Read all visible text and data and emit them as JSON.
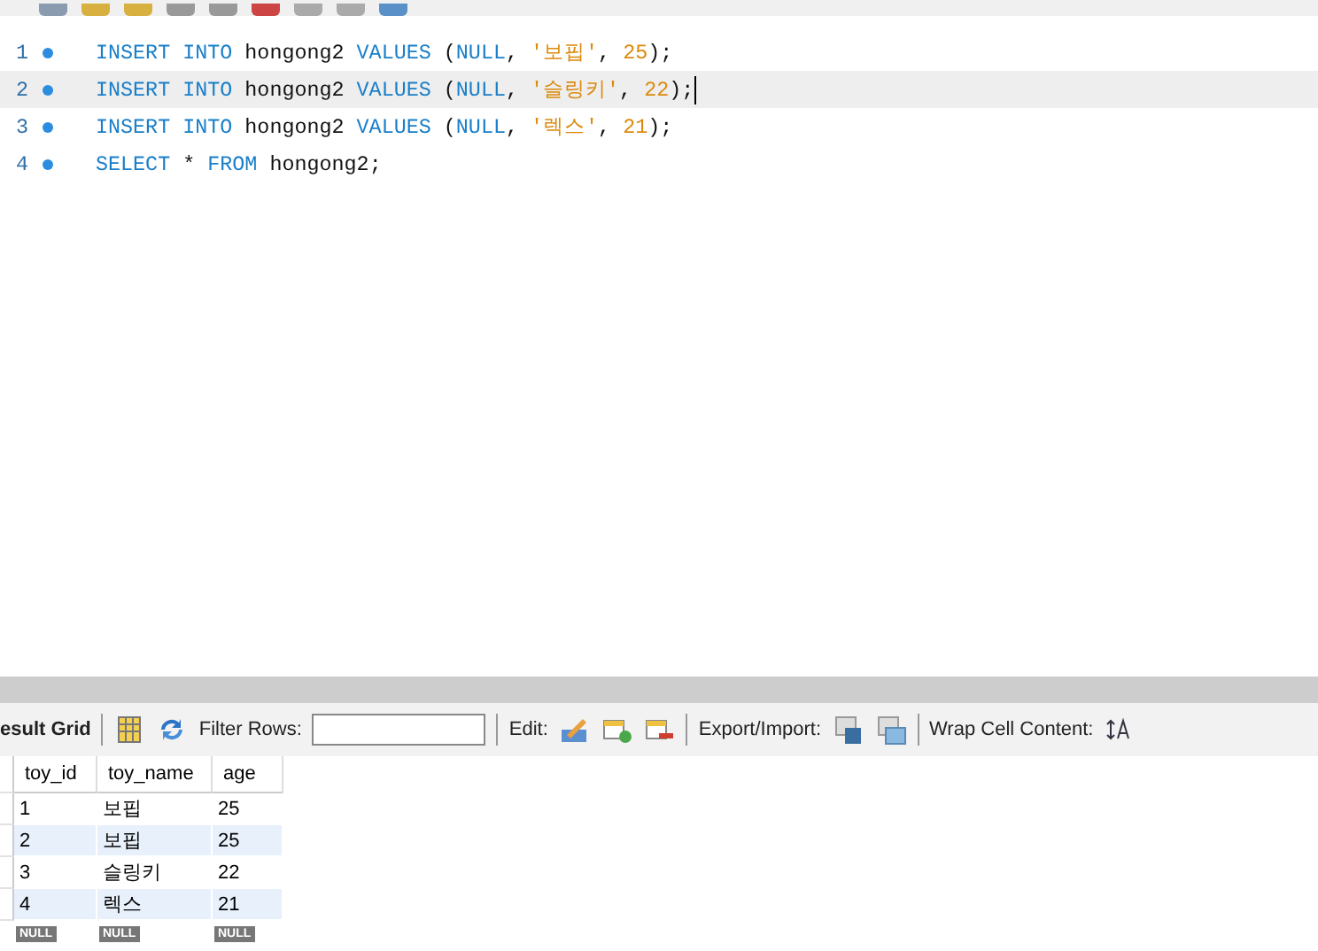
{
  "editor": {
    "lines": [
      {
        "number": "1",
        "current": false,
        "tokens": [
          {
            "kind": "keyword",
            "text": "INSERT INTO"
          },
          {
            "kind": "plain",
            "text": " hongong2 "
          },
          {
            "kind": "keyword",
            "text": "VALUES"
          },
          {
            "kind": "plain",
            "text": " ("
          },
          {
            "kind": "keyword",
            "text": "NULL"
          },
          {
            "kind": "plain",
            "text": ", "
          },
          {
            "kind": "string",
            "text": "'보핍'"
          },
          {
            "kind": "plain",
            "text": ", "
          },
          {
            "kind": "number",
            "text": "25"
          },
          {
            "kind": "plain",
            "text": ");"
          }
        ]
      },
      {
        "number": "2",
        "current": true,
        "tokens": [
          {
            "kind": "keyword",
            "text": "INSERT INTO"
          },
          {
            "kind": "plain",
            "text": " hongong2 "
          },
          {
            "kind": "keyword",
            "text": "VALUES"
          },
          {
            "kind": "plain",
            "text": " ("
          },
          {
            "kind": "keyword",
            "text": "NULL"
          },
          {
            "kind": "plain",
            "text": ", "
          },
          {
            "kind": "string",
            "text": "'슬링키'"
          },
          {
            "kind": "plain",
            "text": ", "
          },
          {
            "kind": "number",
            "text": "22"
          },
          {
            "kind": "plain",
            "text": ");"
          }
        ]
      },
      {
        "number": "3",
        "current": false,
        "tokens": [
          {
            "kind": "keyword",
            "text": "INSERT INTO"
          },
          {
            "kind": "plain",
            "text": " hongong2 "
          },
          {
            "kind": "keyword",
            "text": "VALUES"
          },
          {
            "kind": "plain",
            "text": " ("
          },
          {
            "kind": "keyword",
            "text": "NULL"
          },
          {
            "kind": "plain",
            "text": ", "
          },
          {
            "kind": "string",
            "text": "'렉스'"
          },
          {
            "kind": "plain",
            "text": ", "
          },
          {
            "kind": "number",
            "text": "21"
          },
          {
            "kind": "plain",
            "text": ");"
          }
        ]
      },
      {
        "number": "4",
        "current": false,
        "tokens": [
          {
            "kind": "keyword",
            "text": "SELECT"
          },
          {
            "kind": "plain",
            "text": " * "
          },
          {
            "kind": "keyword",
            "text": "FROM"
          },
          {
            "kind": "plain",
            "text": " hongong2;"
          }
        ]
      }
    ]
  },
  "result_toolbar": {
    "tab": "esult Grid",
    "filter_label": "Filter Rows:",
    "edit_label": "Edit:",
    "export_label": "Export/Import:",
    "wrap_label": "Wrap Cell Content:"
  },
  "table": {
    "columns": [
      "toy_id",
      "toy_name",
      "age"
    ],
    "rows": [
      [
        "1",
        "보핍",
        "25"
      ],
      [
        "2",
        "보핍",
        "25"
      ],
      [
        "3",
        "슬링키",
        "22"
      ],
      [
        "4",
        "렉스",
        "21"
      ]
    ],
    "new_row": [
      "NULL",
      "NULL",
      "NULL"
    ]
  }
}
